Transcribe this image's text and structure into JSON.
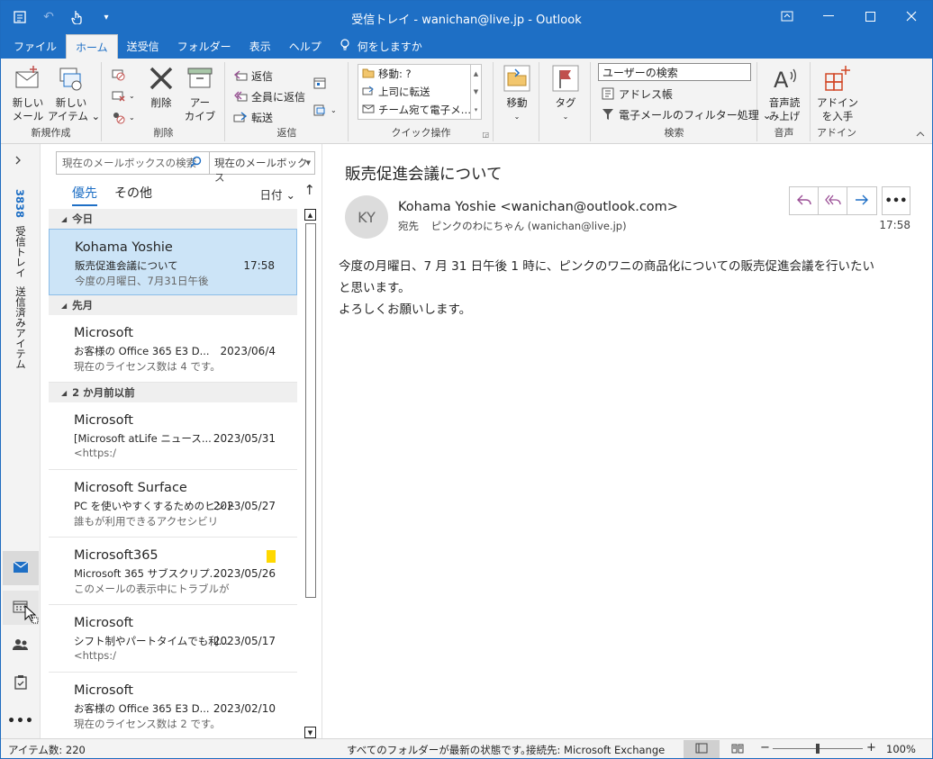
{
  "window": {
    "title": "受信トレイ - wanichan@live.jp  -  Outlook"
  },
  "ribbon_tabs": [
    {
      "label": "ファイル"
    },
    {
      "label": "ホーム"
    },
    {
      "label": "送受信"
    },
    {
      "label": "フォルダー"
    },
    {
      "label": "表示"
    },
    {
      "label": "ヘルプ"
    },
    {
      "label": "何をしますか"
    }
  ],
  "ribbon": {
    "new_group": {
      "label": "新規作成",
      "new_mail": "新しい\nメール",
      "new_items": "新しい\nアイテム ⌄"
    },
    "delete_group": {
      "label": "削除",
      "delete": "削除",
      "archive": "アー\nカイブ"
    },
    "respond_group": {
      "label": "返信",
      "reply": "返信",
      "reply_all": "全員に返信",
      "forward": "転送"
    },
    "quicksteps_group": {
      "label": "クイック操作",
      "items": [
        "移動: ?",
        "上司に転送",
        "チーム宛て電子メ…"
      ]
    },
    "move_group": {
      "move": "移動"
    },
    "tags_group": {
      "tags": "タグ"
    },
    "find_group": {
      "label": "検索",
      "search_people": "ユーザーの検索",
      "address_book": "アドレス帳",
      "filter_email": "電子メールのフィルター処理 ⌄"
    },
    "speech_group": {
      "label": "音声",
      "read_aloud": "音声読\nみ上げ"
    },
    "addins_group": {
      "label": "アドイン",
      "get_addins": "アドイン\nを入手"
    }
  },
  "nav_rail": {
    "inbox_label": "受信トレイ",
    "inbox_count": "3838",
    "sent_label": "送信済みアイテム"
  },
  "message_list": {
    "search_placeholder": "現在のメールボックスの検索",
    "scope": "現在のメールボックス",
    "tabs": [
      "優先",
      "その他"
    ],
    "sort_label": "日付 ⌄",
    "sort_direction": "↑",
    "groups": [
      {
        "header": "今日",
        "items": [
          {
            "from": "Kohama Yoshie",
            "subject": "販売促進会議について",
            "preview": "今度の月曜日、7月31日午後",
            "date": "17:58",
            "selected": true
          }
        ]
      },
      {
        "header": "先月",
        "items": [
          {
            "from": "Microsoft",
            "subject": "お客様の Office 365 E3 D...",
            "preview": "現在のライセンス数は 4 です。",
            "date": "2023/06/4"
          }
        ]
      },
      {
        "header": "2 か月前以前",
        "items": [
          {
            "from": "Microsoft",
            "subject": "[Microsoft atLife ニュース...",
            "preview": " <https:/",
            "date": "2023/05/31"
          },
          {
            "from": "Microsoft Surface",
            "subject": "PC を使いやすくするためのヒント",
            "preview": "誰もが利用できるアクセシビリ",
            "date": "2023/05/27"
          },
          {
            "from": "Microsoft365",
            "subject": "Microsoft 365 サブスクリプ...",
            "preview": "このメールの表示中にトラブルが",
            "date": "2023/05/26",
            "flag": true
          },
          {
            "from": "Microsoft",
            "subject": "シフト制やパートタイムでも利...",
            "preview": " <https:/",
            "date": "2023/05/17"
          },
          {
            "from": "Microsoft",
            "subject": "お客様の Office 365 E3 D...",
            "preview": "現在のライセンス数は 2 です。",
            "date": "2023/02/10"
          }
        ]
      }
    ]
  },
  "reading_pane": {
    "subject": "販売促進会議について",
    "avatar_initials": "KY",
    "sender": "Kohama Yoshie <wanichan@outlook.com>",
    "to_label": "宛先",
    "to": "ピンクのわにちゃん (wanichan@live.jp)",
    "time": "17:58",
    "body": [
      "今度の月曜日、7 月 31 日午後 1 時に、ピンクのワニの商品化についての販売促進会議を行いたい",
      "と思います。",
      "よろしくお願いします。"
    ]
  },
  "status_bar": {
    "item_count": "アイテム数: 220",
    "sync_status": "すべてのフォルダーが最新の状態です。",
    "connection": "接続先: Microsoft Exchange",
    "zoom_minus": "−",
    "zoom_plus": "+",
    "zoom": "100%"
  },
  "colors": {
    "accent": "#1e6fc5",
    "selected_row": "#cce4f7",
    "flag": "#ffd800",
    "reply_purple": "#9b4f96"
  }
}
